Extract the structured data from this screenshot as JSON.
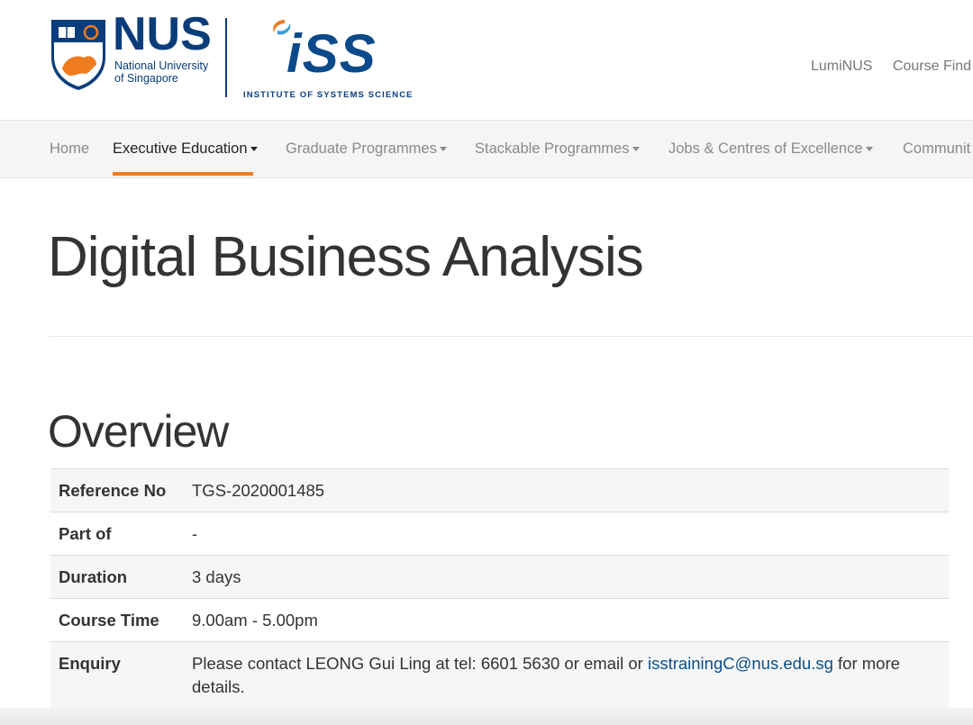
{
  "header": {
    "nus_logo_text": "NUS",
    "nus_sub_line1": "National University",
    "nus_sub_line2": "of Singapore",
    "iss_logo_text": "iSS",
    "iss_subtitle": "INSTITUTE OF SYSTEMS SCIENCE",
    "top_links": [
      "LumiNUS",
      "Course Find"
    ]
  },
  "nav": {
    "items": [
      {
        "label": "Home",
        "dropdown": false
      },
      {
        "label": "Executive Education",
        "dropdown": true,
        "active": true
      },
      {
        "label": "Graduate Programmes",
        "dropdown": true
      },
      {
        "label": "Stackable Programmes",
        "dropdown": true
      },
      {
        "label": "Jobs & Centres of Excellence",
        "dropdown": true
      },
      {
        "label": "Communit",
        "dropdown": false
      }
    ],
    "active_color": "#ef7c1f"
  },
  "page": {
    "title": "Digital Business Analysis",
    "section_title": "Overview"
  },
  "overview": {
    "rows": [
      {
        "label": "Reference No",
        "value": "TGS-2020001485"
      },
      {
        "label": "Part of",
        "value": "-"
      },
      {
        "label": "Duration",
        "value": "3 days"
      },
      {
        "label": "Course Time",
        "value": "9.00am - 5.00pm"
      },
      {
        "label": "Enquiry",
        "value_prefix": "Please contact LEONG Gui Ling at tel: 6601 5630 or email or ",
        "email": "isstrainingC@nus.edu.sg",
        "value_suffix": " for more details."
      }
    ]
  },
  "colors": {
    "brand_blue": "#0a3d7a",
    "link_blue": "#0b4f8a",
    "nav_underline": "#ef7c1f"
  }
}
